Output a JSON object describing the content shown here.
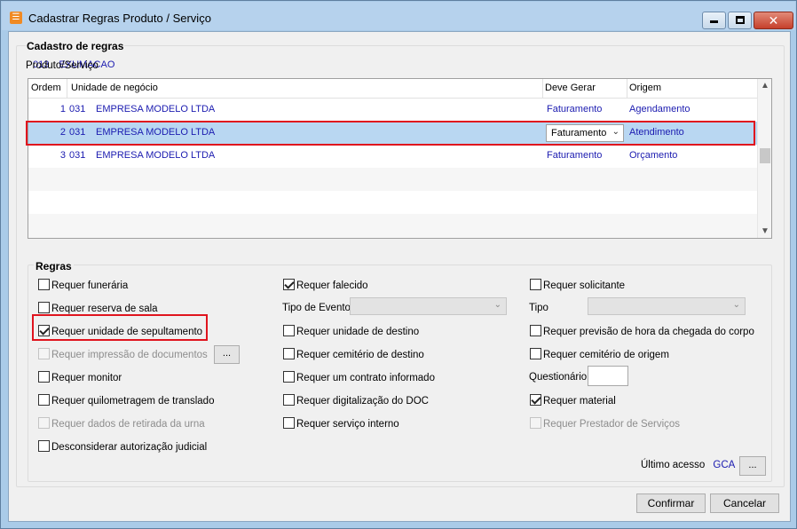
{
  "window": {
    "title": "Cadastrar Regras Produto / Serviço",
    "icon": "app-logo-icon"
  },
  "cadastro": {
    "legend": "Cadastro de regras",
    "produto_label": "Produto/Serviço",
    "produto_codigo": "013",
    "produto_nome": "EXUMACAO"
  },
  "grid": {
    "headers": {
      "ordem": "Ordem",
      "unidade": "Unidade de negócio",
      "deve_gerar": "Deve Gerar",
      "origem": "Origem"
    },
    "rows": [
      {
        "ordem": "1",
        "codigo": "031",
        "unidade": "EMPRESA MODELO LTDA",
        "deve_gerar": "Faturamento",
        "origem": "Agendamento"
      },
      {
        "ordem": "2",
        "codigo": "031",
        "unidade": "EMPRESA MODELO LTDA",
        "deve_gerar": "Faturamento",
        "origem": "Atendimento"
      },
      {
        "ordem": "3",
        "codigo": "031",
        "unidade": "EMPRESA MODELO LTDA",
        "deve_gerar": "Faturamento",
        "origem": "Orçamento"
      }
    ],
    "selected_row": 2
  },
  "regras": {
    "legend": "Regras",
    "col1": {
      "funeraria": {
        "label": "Requer funerária",
        "checked": false,
        "enabled": true
      },
      "reserva_sala": {
        "label": "Requer reserva de sala",
        "checked": false,
        "enabled": true
      },
      "unidade_sepultamento": {
        "label": "Requer unidade de sepultamento",
        "checked": true,
        "enabled": true
      },
      "impressao_docs": {
        "label": "Requer impressão de documentos",
        "checked": false,
        "enabled": false
      },
      "monitor": {
        "label": "Requer monitor",
        "checked": false,
        "enabled": true
      },
      "quilometragem": {
        "label": "Requer quilometragem de translado",
        "checked": false,
        "enabled": true
      },
      "retirada_urna": {
        "label": "Requer dados de retirada da urna",
        "checked": false,
        "enabled": false
      },
      "desconsiderar": {
        "label": "Desconsiderar autorização judicial",
        "checked": false,
        "enabled": true
      }
    },
    "col2": {
      "falecido": {
        "label": "Requer falecido",
        "checked": true,
        "enabled": true
      },
      "tipo_evento_label": "Tipo de Evento",
      "tipo_evento_value": "",
      "unidade_destino": {
        "label": "Requer unidade de destino",
        "checked": false,
        "enabled": true
      },
      "cemiterio_destino": {
        "label": "Requer cemitério de destino",
        "checked": false,
        "enabled": true
      },
      "contrato": {
        "label": "Requer um contrato informado",
        "checked": false,
        "enabled": true
      },
      "digitalizacao": {
        "label": "Requer digitalização do DOC",
        "checked": false,
        "enabled": true
      },
      "servico_interno": {
        "label": "Requer serviço interno",
        "checked": false,
        "enabled": true
      }
    },
    "col3": {
      "solicitante": {
        "label": "Requer solicitante",
        "checked": false,
        "enabled": true
      },
      "tipo_label": "Tipo",
      "tipo_value": "",
      "previsao_hora": {
        "label": "Requer previsão de hora da chegada do corpo",
        "checked": false,
        "enabled": true
      },
      "cemiterio_origem": {
        "label": "Requer cemitério de origem",
        "checked": false,
        "enabled": true
      },
      "questionario_label": "Questionário",
      "questionario_value": "",
      "material": {
        "label": "Requer material",
        "checked": true,
        "enabled": true
      },
      "prestador": {
        "label": "Requer Prestador de Serviços",
        "checked": false,
        "enabled": false
      }
    },
    "ellipsis": "..."
  },
  "ultimo_acesso": {
    "label": "Último acesso",
    "value": "GCA",
    "button": "..."
  },
  "buttons": {
    "confirmar": "Confirmar",
    "cancelar": "Cancelar"
  },
  "colors": {
    "link_blue": "#1b1bb0",
    "selection": "#b9d7f2",
    "highlight_red": "#e0141e"
  }
}
